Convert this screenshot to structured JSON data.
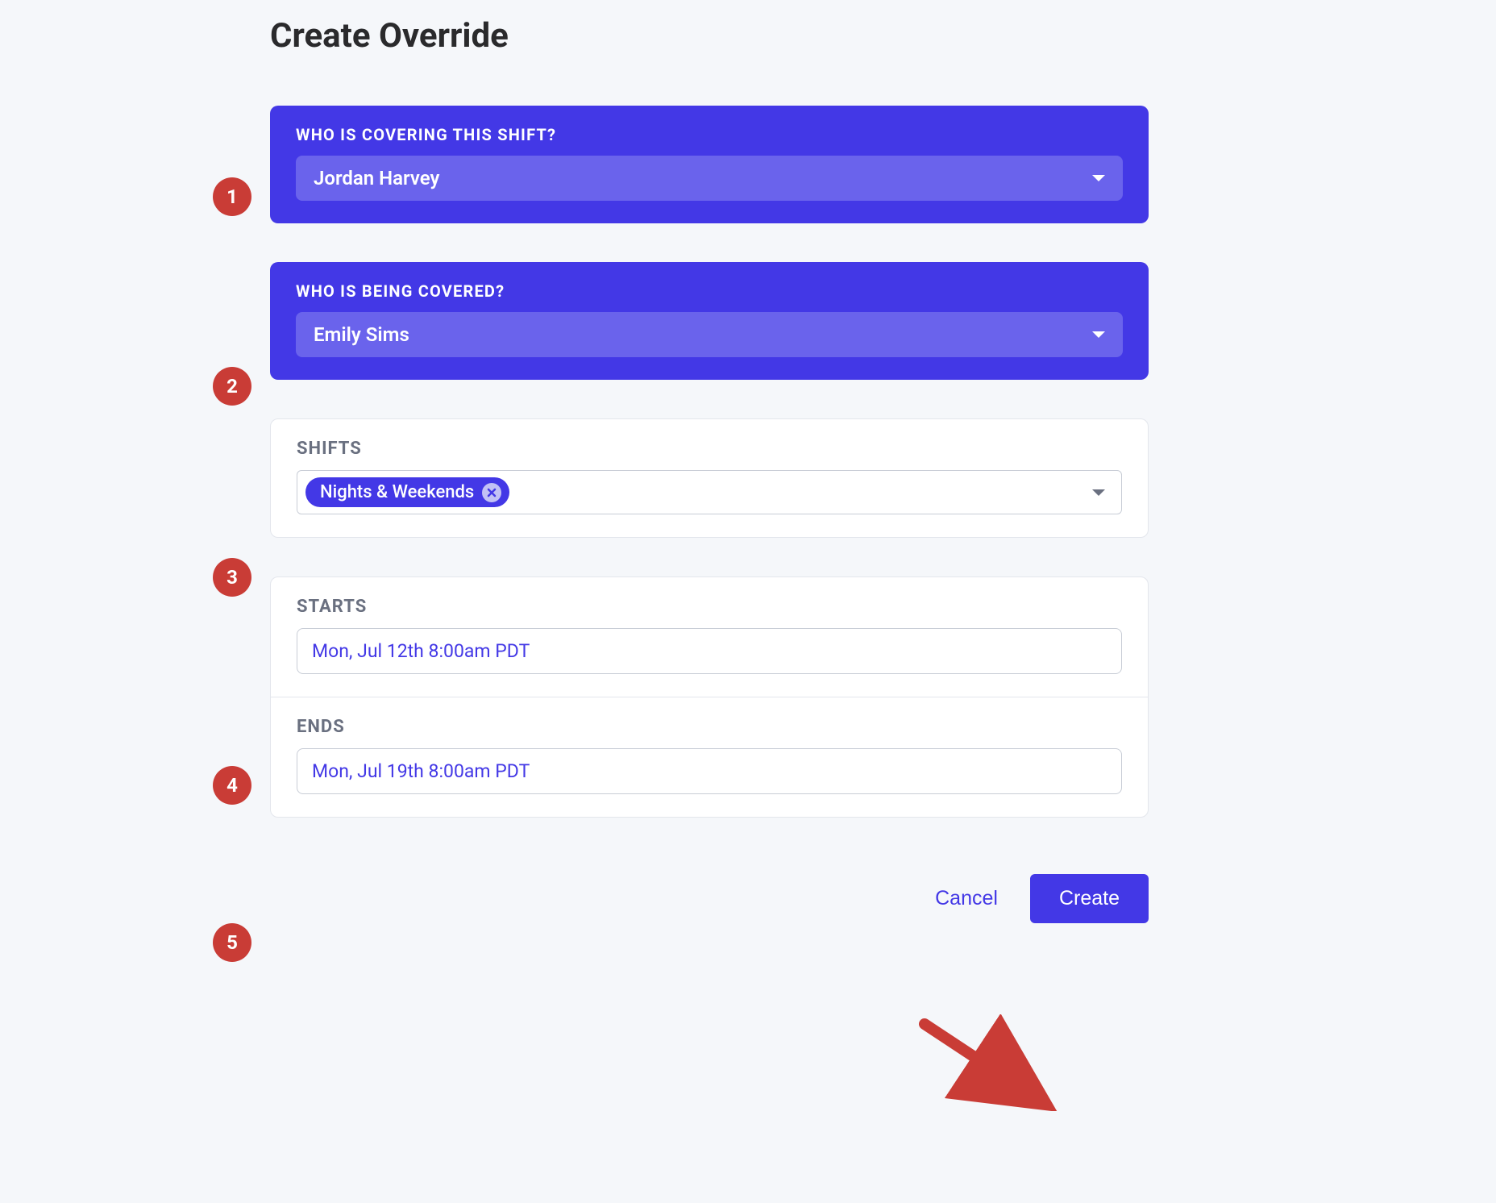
{
  "title": "Create Override",
  "sections": {
    "covering": {
      "label": "WHO IS COVERING THIS SHIFT?",
      "value": "Jordan Harvey"
    },
    "covered": {
      "label": "WHO IS BEING COVERED?",
      "value": "Emily Sims"
    },
    "shifts": {
      "label": "SHIFTS",
      "chip": "Nights & Weekends"
    },
    "starts": {
      "label": "STARTS",
      "value": "Mon, Jul 12th 8:00am PDT"
    },
    "ends": {
      "label": "ENDS",
      "value": "Mon, Jul 19th 8:00am PDT"
    }
  },
  "buttons": {
    "cancel": "Cancel",
    "create": "Create"
  },
  "annotations": {
    "dot1": "1",
    "dot2": "2",
    "dot3": "3",
    "dot4": "4",
    "dot5": "5"
  }
}
